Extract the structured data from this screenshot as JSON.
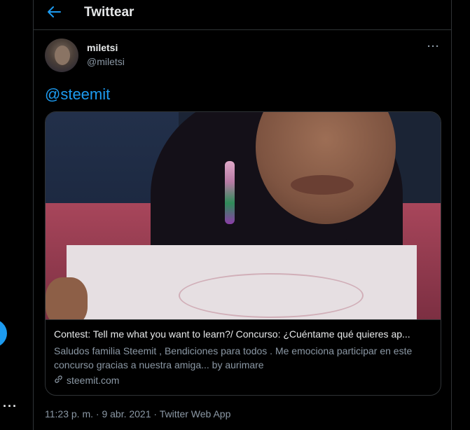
{
  "header": {
    "title": "Twittear",
    "back_icon": "arrow-left-icon"
  },
  "tweet": {
    "author_name": "miletsi",
    "author_handle": "@miletsi",
    "text": "@steemit",
    "more_icon": "more-horizontal-icon"
  },
  "card": {
    "title": "Contest: Tell me what you want to learn?/ Concurso: ¿Cuéntame qué quieres ap...",
    "description": "Saludos familia Steemit , Bendiciones para todos . Me emociona participar en este concurso gracias a nuestra amiga... by aurimare",
    "domain": "steemit.com",
    "link_icon": "link-icon"
  },
  "meta": {
    "time": "11:23 p. m. · 9 abr. 2021 · Twitter Web App"
  },
  "sidebar": {
    "more_label": "···"
  },
  "colors": {
    "accent": "#1d9bf0",
    "background": "#000000",
    "secondary_text": "#8b98a5"
  }
}
